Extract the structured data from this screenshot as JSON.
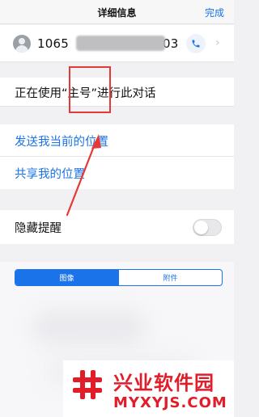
{
  "header": {
    "title": "详细信息",
    "done_label": "完成"
  },
  "contact": {
    "number_prefix": "1065",
    "number_suffix": "03",
    "call_icon": "phone-icon",
    "chevron_icon": "chevron-right-icon"
  },
  "using_row": {
    "label": "正在使用“主号”进行此对话"
  },
  "location": {
    "send_current": "发送我当前的位置",
    "share_my": "共享我的位置"
  },
  "hide_alerts": {
    "label": "隐藏提醒",
    "enabled": false
  },
  "segments": {
    "images": "图像",
    "attachments": "附件",
    "selected": "图像"
  },
  "watermark": {
    "name": "兴业软件园",
    "url": "MYXYJS.COM"
  },
  "colors": {
    "accent": "#1a73e8",
    "annotation_red": "#e53935",
    "watermark_red": "#e11d2a"
  }
}
